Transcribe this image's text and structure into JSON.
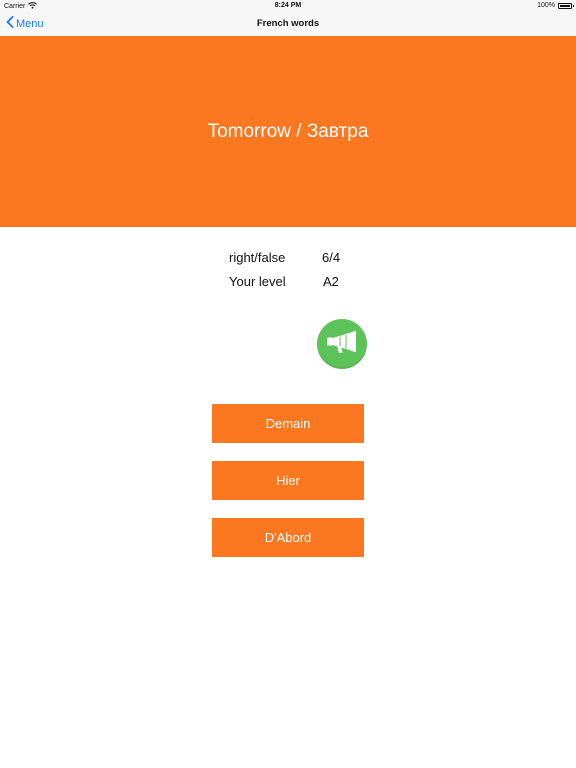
{
  "status_bar": {
    "carrier": "Carrier",
    "time": "8:24 PM",
    "battery": "100%",
    "battery_level": 1.0
  },
  "nav": {
    "back_label": "Menu",
    "title": "French words"
  },
  "word": {
    "text": "Tomorrow / Завтра"
  },
  "stats": {
    "score_label": "right/false",
    "score_value": "6/4",
    "level_label": "Your level",
    "level_value": "A2"
  },
  "speak": {
    "icon": "megaphone-icon"
  },
  "answers": [
    {
      "label": "Demain"
    },
    {
      "label": "Hier"
    },
    {
      "label": "D'Abord"
    }
  ],
  "colors": {
    "accent": "#fc7820",
    "speak_button": "#5ec25a",
    "link": "#1a7cf3"
  }
}
